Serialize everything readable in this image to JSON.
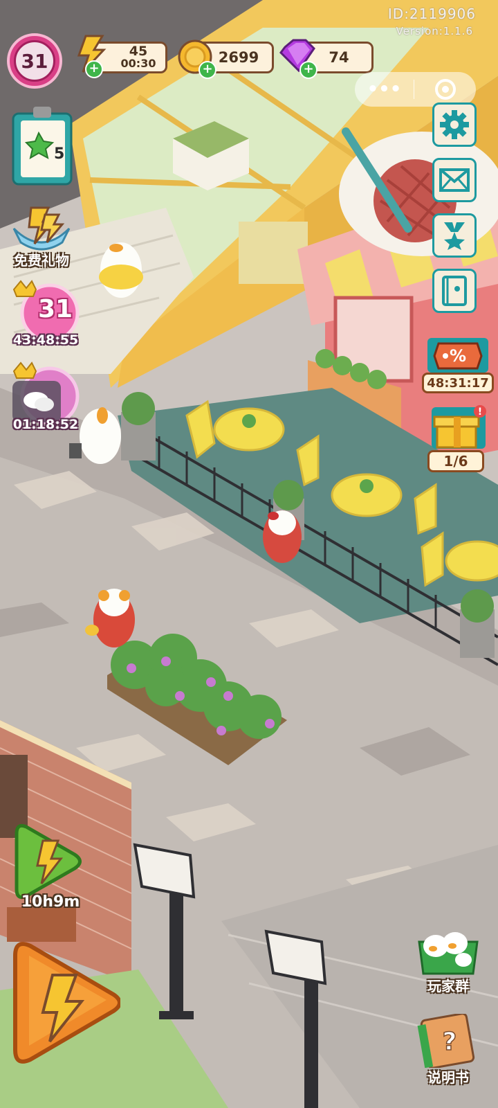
{
  "header": {
    "player_id": "ID:2119906",
    "version": "Version:1.1.6",
    "level": "31"
  },
  "resources": {
    "energy": {
      "value": "45",
      "timer": "00:30",
      "icon": "lightning-icon"
    },
    "coins": {
      "value": "2699",
      "icon": "coin-icon"
    },
    "gems": {
      "value": "74",
      "icon": "gem-icon"
    }
  },
  "left_panel": {
    "task_board_count": "5",
    "free_gift_label": "免费礼物",
    "event_badge": {
      "number": "31",
      "timer": "43:48:55"
    },
    "chat_badge": {
      "timer": "01:18:52"
    },
    "energy_refill_timer": "10h9m"
  },
  "right_panel": {
    "sale_timer": "48:31:17",
    "gift_progress": "1/6",
    "player_group_label": "玩家群",
    "manual_label": "说明书"
  },
  "colors": {
    "accent_teal": "#1d9aa0",
    "level_pink": "#d93f86",
    "resource_border": "#7a4b2c"
  }
}
